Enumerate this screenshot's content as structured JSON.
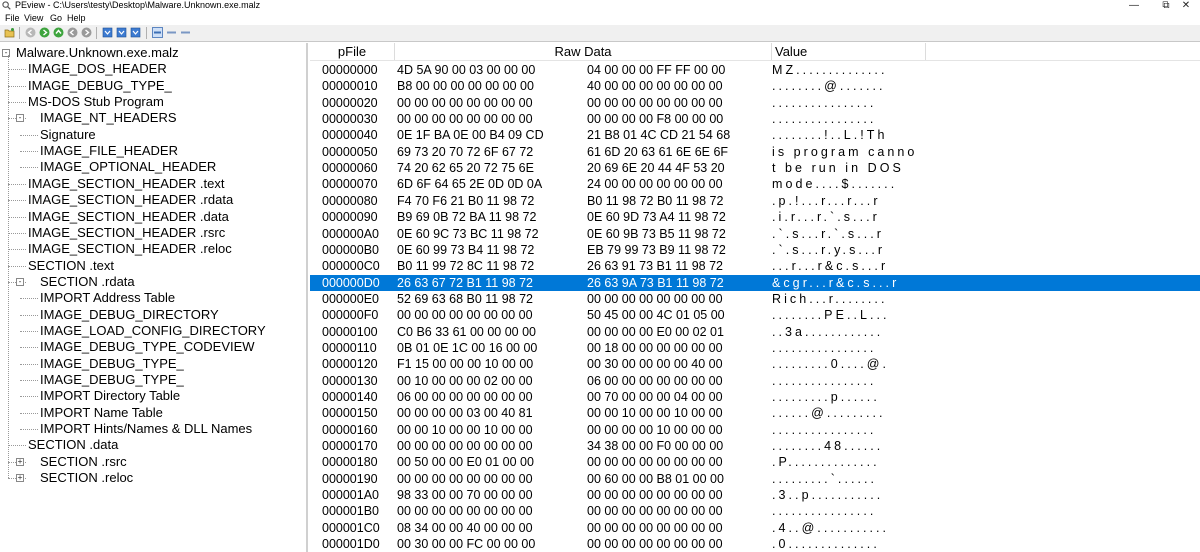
{
  "window": {
    "title": "PEview - C:\\Users\\testy\\Desktop\\Malware.Unknown.exe.malz",
    "controls": {
      "minimize": "—",
      "maximize": "⧉",
      "close": "✕"
    }
  },
  "menu": [
    "File",
    "View",
    "Go",
    "Help"
  ],
  "toolbar": {
    "buttons": [
      "open-icon",
      "back-icon",
      "forward-icon",
      "up-icon",
      "prev-icon",
      "next-icon",
      "save-icon",
      "export-icon",
      "export2-icon",
      "byte-view-icon",
      "word-view-icon",
      "dword-view-icon"
    ]
  },
  "tree": {
    "items": [
      {
        "label": "Malware.Unknown.exe.malz",
        "depth": 0,
        "expander": "-"
      },
      {
        "label": "IMAGE_DOS_HEADER",
        "depth": 1
      },
      {
        "label": "IMAGE_DEBUG_TYPE_",
        "depth": 1
      },
      {
        "label": "MS-DOS Stub Program",
        "depth": 1
      },
      {
        "label": "IMAGE_NT_HEADERS",
        "depth": 1,
        "expander": "-"
      },
      {
        "label": "Signature",
        "depth": 2
      },
      {
        "label": "IMAGE_FILE_HEADER",
        "depth": 2
      },
      {
        "label": "IMAGE_OPTIONAL_HEADER",
        "depth": 2
      },
      {
        "label": "IMAGE_SECTION_HEADER .text",
        "depth": 1
      },
      {
        "label": "IMAGE_SECTION_HEADER .rdata",
        "depth": 1
      },
      {
        "label": "IMAGE_SECTION_HEADER .data",
        "depth": 1
      },
      {
        "label": "IMAGE_SECTION_HEADER .rsrc",
        "depth": 1
      },
      {
        "label": "IMAGE_SECTION_HEADER .reloc",
        "depth": 1
      },
      {
        "label": "SECTION .text",
        "depth": 1
      },
      {
        "label": "SECTION .rdata",
        "depth": 1,
        "expander": "-"
      },
      {
        "label": "IMPORT Address Table",
        "depth": 2
      },
      {
        "label": "IMAGE_DEBUG_DIRECTORY",
        "depth": 2
      },
      {
        "label": "IMAGE_LOAD_CONFIG_DIRECTORY",
        "depth": 2
      },
      {
        "label": "IMAGE_DEBUG_TYPE_CODEVIEW",
        "depth": 2
      },
      {
        "label": "IMAGE_DEBUG_TYPE_",
        "depth": 2
      },
      {
        "label": "IMAGE_DEBUG_TYPE_",
        "depth": 2
      },
      {
        "label": "IMPORT Directory Table",
        "depth": 2
      },
      {
        "label": "IMPORT Name Table",
        "depth": 2
      },
      {
        "label": "IMPORT Hints/Names & DLL Names",
        "depth": 2
      },
      {
        "label": "SECTION .data",
        "depth": 1
      },
      {
        "label": "SECTION .rsrc",
        "depth": 1,
        "expander": "+"
      },
      {
        "label": "SECTION .reloc",
        "depth": 1,
        "expander": "+"
      }
    ]
  },
  "table": {
    "headers": {
      "offset": "pFile",
      "raw": "Raw Data",
      "value": "Value"
    },
    "selected_index": 13,
    "rows": [
      {
        "off": "00000000",
        "raw1": "4D 5A 90 00 03 00 00 00",
        "raw2": "04 00 00 00 FF FF 00 00",
        "val": "MZ.............."
      },
      {
        "off": "00000010",
        "raw1": "B8 00 00 00 00 00 00 00",
        "raw2": "40 00 00 00 00 00 00 00",
        "val": "........@......."
      },
      {
        "off": "00000020",
        "raw1": "00 00 00 00 00 00 00 00",
        "raw2": "00 00 00 00 00 00 00 00",
        "val": "................"
      },
      {
        "off": "00000030",
        "raw1": "00 00 00 00 00 00 00 00",
        "raw2": "00 00 00 00 F8 00 00 00",
        "val": "................"
      },
      {
        "off": "00000040",
        "raw1": "0E 1F BA 0E 00 B4 09 CD",
        "raw2": "21 B8 01 4C CD 21 54 68",
        "val": "........!..L.!Th"
      },
      {
        "off": "00000050",
        "raw1": "69 73 20 70 72 6F 67 72",
        "raw2": "61 6D 20 63 61 6E 6E 6F",
        "val": "is program canno"
      },
      {
        "off": "00000060",
        "raw1": "74 20 62 65 20 72 75 6E",
        "raw2": "20 69 6E 20 44 4F 53 20",
        "val": "t be run in DOS "
      },
      {
        "off": "00000070",
        "raw1": "6D 6F 64 65 2E 0D 0D 0A",
        "raw2": "24 00 00 00 00 00 00 00",
        "val": "mode....$......."
      },
      {
        "off": "00000080",
        "raw1": "F4 70 F6 21 B0 11 98 72",
        "raw2": "B0 11 98 72 B0 11 98 72",
        "val": ".p.!...r...r...r"
      },
      {
        "off": "00000090",
        "raw1": "B9 69 0B 72 BA 11 98 72",
        "raw2": "0E 60 9D 73 A4 11 98 72",
        "val": ".i.r...r.`.s...r"
      },
      {
        "off": "000000A0",
        "raw1": "0E 60 9C 73 BC 11 98 72",
        "raw2": "0E 60 9B 73 B5 11 98 72",
        "val": ".`.s...r.`.s...r"
      },
      {
        "off": "000000B0",
        "raw1": "0E 60 99 73 B4 11 98 72",
        "raw2": "EB 79 99 73 B9 11 98 72",
        "val": ".`.s...r.y.s...r"
      },
      {
        "off": "000000C0",
        "raw1": "B0 11 99 72 8C 11 98 72",
        "raw2": "26 63 91 73 B1 11 98 72",
        "val": "...r...r&c.s...r"
      },
      {
        "off": "000000D0",
        "raw1": "26 63 67 72 B1 11 98 72",
        "raw2": "26 63 9A 73 B1 11 98 72",
        "val": "&cgr...r&c.s...r"
      },
      {
        "off": "000000E0",
        "raw1": "52 69 63 68 B0 11 98 72",
        "raw2": "00 00 00 00 00 00 00 00",
        "val": "Rich...r........"
      },
      {
        "off": "000000F0",
        "raw1": "00 00 00 00 00 00 00 00",
        "raw2": "50 45 00 00 4C 01 05 00",
        "val": "........PE..L..."
      },
      {
        "off": "00000100",
        "raw1": "C0 B6 33 61 00 00 00 00",
        "raw2": "00 00 00 00 E0 00 02 01",
        "val": "..3a............"
      },
      {
        "off": "00000110",
        "raw1": "0B 01 0E 1C 00 16 00 00",
        "raw2": "00 18 00 00 00 00 00 00",
        "val": "................"
      },
      {
        "off": "00000120",
        "raw1": "F1 15 00 00 00 10 00 00",
        "raw2": "00 30 00 00 00 00 40 00",
        "val": ".........0....@."
      },
      {
        "off": "00000130",
        "raw1": "00 10 00 00 00 02 00 00",
        "raw2": "06 00 00 00 00 00 00 00",
        "val": "................"
      },
      {
        "off": "00000140",
        "raw1": "06 00 00 00 00 00 00 00",
        "raw2": "00 70 00 00 00 04 00 00",
        "val": ".........p......"
      },
      {
        "off": "00000150",
        "raw1": "00 00 00 00 03 00 40 81",
        "raw2": "00 00 10 00 00 10 00 00",
        "val": "......@........."
      },
      {
        "off": "00000160",
        "raw1": "00 00 10 00 00 10 00 00",
        "raw2": "00 00 00 00 10 00 00 00",
        "val": "................"
      },
      {
        "off": "00000170",
        "raw1": "00 00 00 00 00 00 00 00",
        "raw2": "34 38 00 00 F0 00 00 00",
        "val": "........48......"
      },
      {
        "off": "00000180",
        "raw1": "00 50 00 00 E0 01 00 00",
        "raw2": "00 00 00 00 00 00 00 00",
        "val": ".P.............."
      },
      {
        "off": "00000190",
        "raw1": "00 00 00 00 00 00 00 00",
        "raw2": "00 60 00 00 B8 01 00 00",
        "val": ".........`......"
      },
      {
        "off": "000001A0",
        "raw1": "98 33 00 00 70 00 00 00",
        "raw2": "00 00 00 00 00 00 00 00",
        "val": ".3..p..........."
      },
      {
        "off": "000001B0",
        "raw1": "00 00 00 00 00 00 00 00",
        "raw2": "00 00 00 00 00 00 00 00",
        "val": "................"
      },
      {
        "off": "000001C0",
        "raw1": "08 34 00 00 40 00 00 00",
        "raw2": "00 00 00 00 00 00 00 00",
        "val": ".4..@..........."
      },
      {
        "off": "000001D0",
        "raw1": "00 30 00 00 FC 00 00 00",
        "raw2": "00 00 00 00 00 00 00 00",
        "val": ".0.............."
      }
    ]
  },
  "colors": {
    "selection": "#0078d7",
    "selection_text": "#ffffff"
  }
}
